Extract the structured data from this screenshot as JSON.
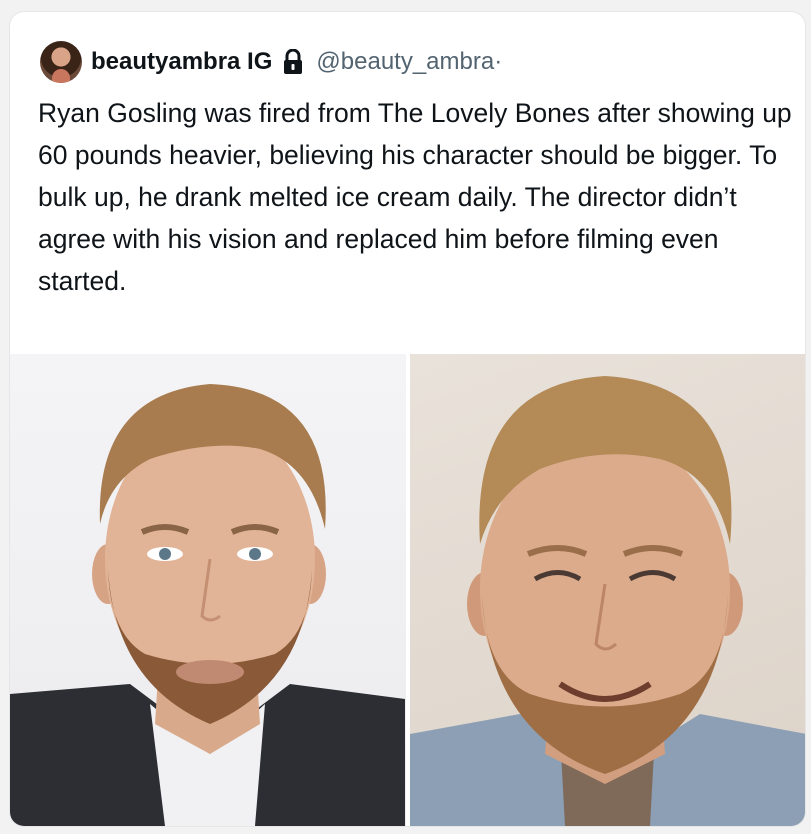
{
  "tweet": {
    "display_name": "beautyambra IG",
    "handle": "@beauty_ambra",
    "separator": "·",
    "text": "Ryan Gosling was fired from The Lovely Bones after showing up 60 pounds heavier, believing his character should be bigger. To bulk up, he drank melted ice cream daily. The director didn’t agree with his vision and replaced him before filming even started."
  },
  "icons": {
    "avatar": "profile-avatar",
    "verified": "lock-icon"
  },
  "colors": {
    "text_primary": "#0f1419",
    "text_secondary": "#536471",
    "card_bg": "#ffffff"
  }
}
